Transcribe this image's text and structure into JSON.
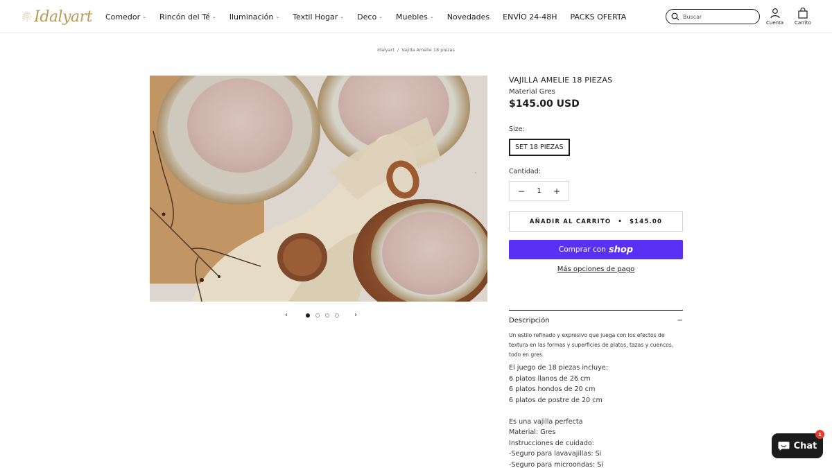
{
  "brand": {
    "name": "Idalyart"
  },
  "nav": [
    {
      "label": "Comedor",
      "dropdown": true
    },
    {
      "label": "Rincón del Té",
      "dropdown": true
    },
    {
      "label": "Iluminación",
      "dropdown": true
    },
    {
      "label": "Textil Hogar",
      "dropdown": true
    },
    {
      "label": "Deco",
      "dropdown": true
    },
    {
      "label": "Muebles",
      "dropdown": true
    },
    {
      "label": "Novedades",
      "dropdown": false
    },
    {
      "label": "ENVÍO 24-48H",
      "dropdown": false
    },
    {
      "label": "PACKS OFERTA",
      "dropdown": false
    }
  ],
  "search": {
    "placeholder": "Buscar"
  },
  "header_icons": {
    "account_label": "Cuenta",
    "cart_label": "Carrito"
  },
  "breadcrumb": {
    "home": "Idalyart",
    "separator": "/",
    "current": "Vajilla Amelie 18 piezas"
  },
  "carousel": {
    "slides": 4,
    "active": 1
  },
  "product": {
    "title": "VAJILLA AMELIE 18 PIEZAS",
    "subtitle": "Material Gres",
    "price": "$145.00 USD",
    "size_label": "Size:",
    "size_option": "SET 18 PIEZAS",
    "quantity_label": "Cantidad:",
    "quantity": "1",
    "add_to_cart": "AÑADIR AL CARRITO",
    "add_to_cart_bullet": "•",
    "add_to_cart_price": "$145.00",
    "shop_pay_prefix": "Comprar con",
    "shop_pay_brand": "shop",
    "shop_pay_color": "#5a31f4",
    "more_payment": "Más opciones de pago"
  },
  "description": {
    "heading": "Descripción",
    "intro": "Un estilo refinado y expresivo que juega con los efectos de textura en las formas y superficies de platos, tazas y cuencos, todo en gres.",
    "lines": [
      "El juego de 18 piezas incluye:",
      "6 platos llanos de 26 cm",
      "6 platos hondos de 20 cm",
      "6 platos de postre de 20 cm",
      "",
      "Es una vajilla perfecta",
      "Material: Gres",
      "Instrucciones de cuidado:",
      "-Seguro para lavavajillas: Si",
      "-Seguro para microondas: Si"
    ]
  },
  "chat": {
    "label": "Chat",
    "badge": "1",
    "badge_color": "#e7382c"
  }
}
